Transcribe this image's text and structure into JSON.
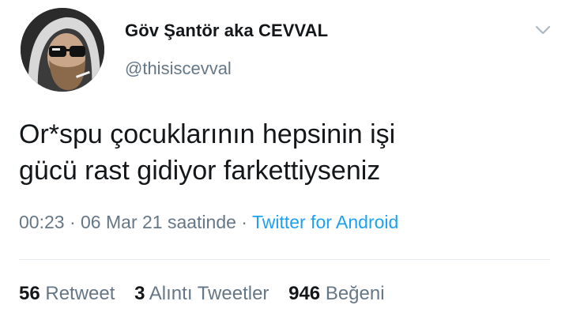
{
  "user": {
    "display_name": "Göv Şantör aka CEVVAL",
    "handle": "@thisiscevval"
  },
  "tweet": {
    "line1": "Or*spu çocuklarının hepsinin işi",
    "line2": "gücü rast gidiyor farkettiyseniz"
  },
  "meta": {
    "time": "00:23",
    "sep1": " · ",
    "date": "06 Mar 21 saatinde",
    "sep2": " · ",
    "source": "Twitter for Android"
  },
  "stats": {
    "retweets_count": "56",
    "retweets_label": "Retweet",
    "quotes_count": "3",
    "quotes_label": "Alıntı Tweetler",
    "likes_count": "946",
    "likes_label": "Beğeni"
  },
  "icons": {
    "avatar": "profile-photo",
    "caret": "chevron-down-icon"
  },
  "colors": {
    "text": "#14171a",
    "secondary": "#657786",
    "link": "#1da1f2",
    "divider": "#e6ecf0"
  }
}
